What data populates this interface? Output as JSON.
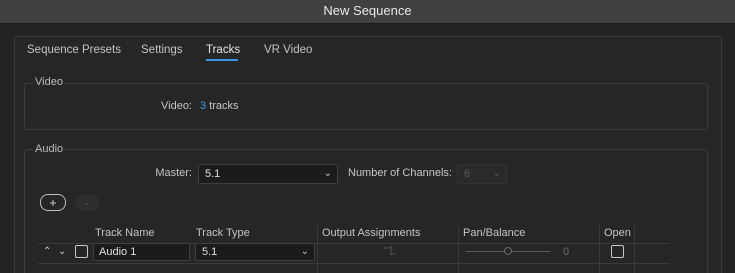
{
  "window": {
    "title": "New Sequence"
  },
  "tabs": [
    {
      "label": "Sequence Presets",
      "active": false
    },
    {
      "label": "Settings",
      "active": false
    },
    {
      "label": "Tracks",
      "active": true
    },
    {
      "label": "VR Video",
      "active": false
    }
  ],
  "video": {
    "section_label": "Video",
    "field_label": "Video:",
    "track_count": "3",
    "track_unit": "tracks"
  },
  "audio": {
    "section_label": "Audio",
    "master_label": "Master:",
    "master_value": "5.1",
    "channels_label": "Number of Channels:",
    "channels_value": "6",
    "add_button": "+",
    "remove_button": "-",
    "columns": [
      "Track Name",
      "Track Type",
      "Output Assignments",
      "Pan/Balance",
      "Open"
    ],
    "tracks": [
      {
        "name": "Audio 1",
        "type": "5.1",
        "pan_value": "0"
      }
    ]
  },
  "colors": {
    "accent": "#3a95e8",
    "background": "#232323",
    "titlebar": "#404040"
  },
  "icons": {
    "dropdown": "chevron-down-icon",
    "collapse": "chevron-up-icon",
    "output": "output-assignment-icon"
  }
}
